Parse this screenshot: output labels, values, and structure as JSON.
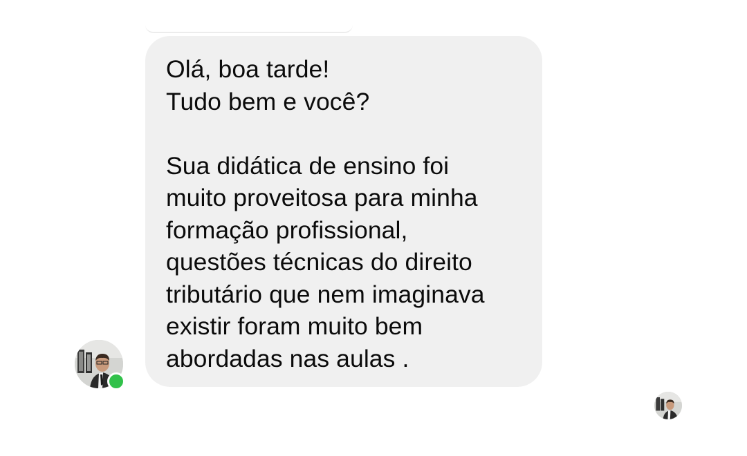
{
  "conversation": {
    "incoming_message": {
      "text": "Olá, boa tarde!\nTudo bem e você?\n\nSua didática de ensino foi\nmuito proveitosa para minha\nformação profissional,\nquestões técnicas do direito\ntributário que nem imaginava\nexistir foram muito bem\nabordadas nas aulas ."
    },
    "sender": {
      "avatar_icon": "profile-photo",
      "online_status_color": "#31c14a"
    },
    "read_receipt": {
      "avatar_icon": "seen-profile-photo"
    }
  },
  "colors": {
    "bubble_background": "#f0f0f0",
    "text": "#0b0b0b",
    "page_background": "#ffffff"
  }
}
